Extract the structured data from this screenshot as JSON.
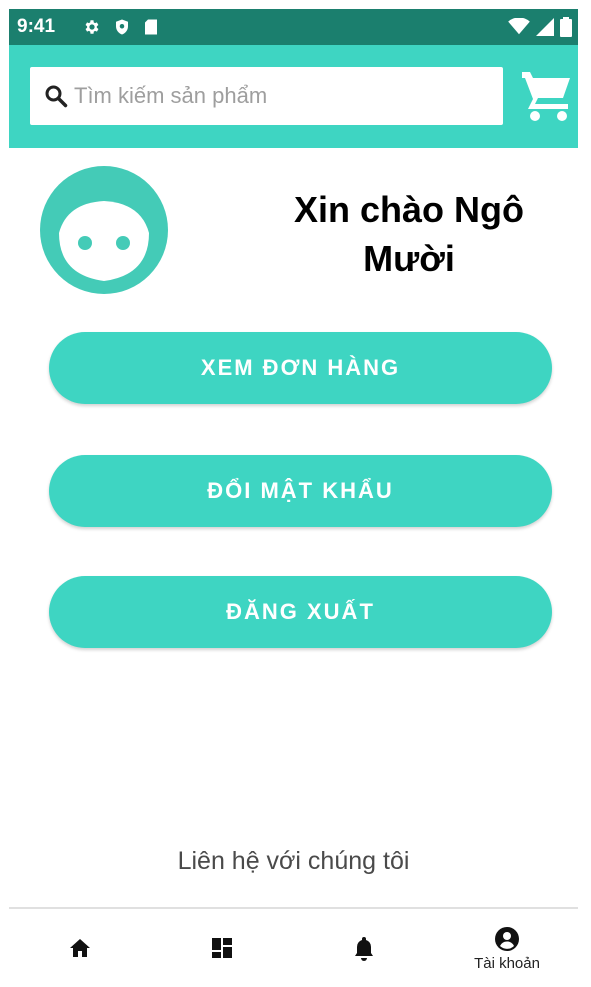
{
  "status_bar": {
    "time": "9:41",
    "icons_left": [
      "gear-icon",
      "shield-icon",
      "sd-card-icon"
    ],
    "icons_right": [
      "wifi-icon",
      "signal-icon",
      "battery-icon"
    ]
  },
  "header": {
    "search_placeholder": "Tìm kiếm sản phẩm",
    "search_icon": "search-icon",
    "cart_icon": "cart-icon"
  },
  "profile": {
    "avatar_icon": "face-avatar-icon",
    "greeting_line1": "Xin chào Ngô",
    "greeting_line2": "Mười"
  },
  "actions": {
    "view_orders": "XEM ĐƠN HÀNG",
    "change_password": "ĐỔI MẬT KHẨU",
    "logout": "ĐĂNG XUẤT"
  },
  "contact": {
    "label": "Liên hệ với chúng tôi"
  },
  "bottom_nav": {
    "items": [
      {
        "icon": "home-icon",
        "label": ""
      },
      {
        "icon": "dashboard-icon",
        "label": ""
      },
      {
        "icon": "bell-icon",
        "label": ""
      },
      {
        "icon": "account-icon",
        "label": "Tài khoản"
      }
    ]
  },
  "colors": {
    "accent": "#3ed5c2",
    "status_bar": "#1b7f6e",
    "text_dark": "#000000",
    "text_muted": "#4a4a4a"
  }
}
